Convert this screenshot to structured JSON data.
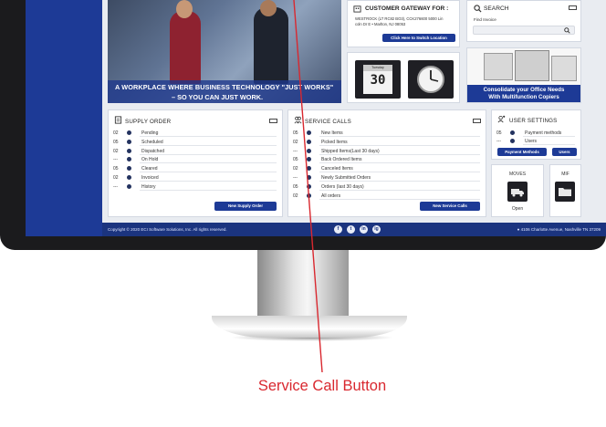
{
  "hero": {
    "caption_line1": "A WORKPLACE WHERE BUSINESS TECHNOLOGY \"JUST WORKS\"",
    "caption_line2": "– SO YOU CAN JUST WORK."
  },
  "gateway": {
    "title": "CUSTOMER GATEWAY FOR :",
    "account_line1": "WESTROCK (LT RC82 BO3), CCK276600 5000 Lin",
    "account_line2": "coln Dr E • Marlton, NJ 08053",
    "switch_button": "Click Here to Switch Location"
  },
  "calendar_tile": {
    "label": "Tuesday",
    "day": "30"
  },
  "search": {
    "title": "SEARCH",
    "find_label": "Find Invoice"
  },
  "promo": {
    "line1": "Consolidate your Office Needs",
    "line2": "With Multifunction Copiers"
  },
  "supply_order": {
    "title": "SUPPLY ORDER",
    "rows": [
      {
        "count": "02",
        "label": "Pending"
      },
      {
        "count": "05",
        "label": "Scheduled"
      },
      {
        "count": "02",
        "label": "Dispatched"
      },
      {
        "count": "---",
        "label": "On Hold"
      },
      {
        "count": "05",
        "label": "Cleared"
      },
      {
        "count": "02",
        "label": "Invoiced"
      },
      {
        "count": "---",
        "label": "History"
      }
    ],
    "button": "New Supply Order"
  },
  "service_calls": {
    "title": "SERVICE CALLS",
    "rows": [
      {
        "count": "05",
        "label": "New Items"
      },
      {
        "count": "02",
        "label": "Picked Items"
      },
      {
        "count": "---",
        "label": "Shipped Items(Last 30 days)"
      },
      {
        "count": "05",
        "label": "Back Ordered Items"
      },
      {
        "count": "02",
        "label": "Canceled Items"
      },
      {
        "count": "---",
        "label": "Newly Submitted Orders"
      },
      {
        "count": "05",
        "label": "Orders (last 30 days)"
      },
      {
        "count": "02",
        "label": "All orders"
      }
    ],
    "button": "New Service Calls"
  },
  "user_settings": {
    "title": "USER SETTINGS",
    "rows": [
      {
        "count": "05",
        "label": "Payment methods"
      },
      {
        "count": "---",
        "label": "Users"
      }
    ],
    "payment_button": "Payment Methods",
    "users_button": "Users"
  },
  "moves": {
    "label": "MOVES",
    "sub": "Open"
  },
  "mif": {
    "label": "MIF"
  },
  "footer": {
    "copyright": "Copyright © 2020 ECI Software Solutions, Inc. All rights reserved.",
    "address": "4106 Charlotte Avenue, Nashville TN 37209",
    "social": [
      "f",
      "t",
      "in",
      "ig"
    ]
  },
  "annotation": {
    "label": "Service Call Button",
    "color": "#d9282f"
  }
}
